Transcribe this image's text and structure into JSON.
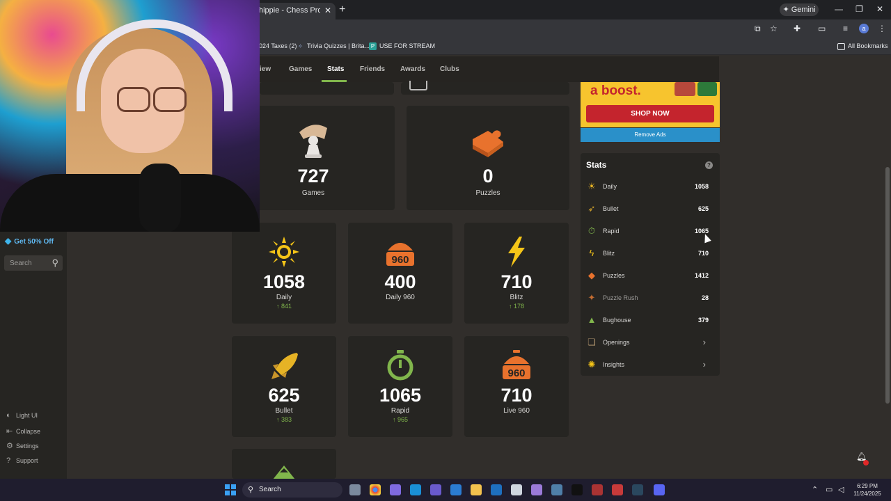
{
  "browser": {
    "tab_title": "hippie - Chess Profile - C",
    "tab_close": "✕",
    "new_tab": "+",
    "gemini_label": "Gemini",
    "bookmarks": [
      {
        "label": "024 Taxes (2)"
      },
      {
        "label": "Trivia Quizzes | Brita..."
      },
      {
        "label": "USE FOR STREAM"
      }
    ],
    "all_bookmarks": "All Bookmarks",
    "avatar_initial": "a"
  },
  "sidebar": {
    "promo": "Get 50% Off",
    "search_placeholder": "Search",
    "links": [
      {
        "label": "Light UI",
        "icon": "contrast-icon"
      },
      {
        "label": "Collapse",
        "icon": "collapse-icon"
      },
      {
        "label": "Settings",
        "icon": "gear-icon"
      },
      {
        "label": "Support",
        "icon": "help-icon"
      }
    ]
  },
  "nav": {
    "items": [
      {
        "label": "iew"
      },
      {
        "label": "Games"
      },
      {
        "label": "Stats"
      },
      {
        "label": "Friends"
      },
      {
        "label": "Awards"
      },
      {
        "label": "Clubs"
      }
    ],
    "active": "Stats"
  },
  "summary": [
    {
      "value": "727",
      "label": "Games",
      "icon": "pawn-hand-icon"
    },
    {
      "value": "0",
      "label": "Puzzles",
      "icon": "puzzle-icon"
    }
  ],
  "ratings": [
    {
      "value": "1058",
      "label": "Daily",
      "delta": "841",
      "icon": "sun-icon"
    },
    {
      "value": "400",
      "label": "Daily 960",
      "delta": "",
      "icon": "daily960-icon"
    },
    {
      "value": "710",
      "label": "Blitz",
      "delta": "178",
      "icon": "lightning-icon"
    },
    {
      "value": "625",
      "label": "Bullet",
      "delta": "383",
      "icon": "bullet-icon"
    },
    {
      "value": "1065",
      "label": "Rapid",
      "delta": "965",
      "icon": "stopwatch-icon"
    },
    {
      "value": "710",
      "label": "Live 960",
      "delta": "",
      "icon": "live960-icon"
    }
  ],
  "ad": {
    "headline": "a boost.",
    "button": "SHOP NOW",
    "remove": "Remove Ads"
  },
  "stats_panel": {
    "title": "Stats",
    "help": "?",
    "rows": [
      {
        "name": "Daily",
        "value": "1058",
        "icon": "sun-icon",
        "color": "#e6b325"
      },
      {
        "name": "Bullet",
        "value": "625",
        "icon": "bullet-icon",
        "color": "#d9a82b"
      },
      {
        "name": "Rapid",
        "value": "1065",
        "icon": "stopwatch-icon",
        "color": "#81b64c"
      },
      {
        "name": "Blitz",
        "value": "710",
        "icon": "lightning-icon",
        "color": "#f5c518"
      },
      {
        "name": "Puzzles",
        "value": "1412",
        "icon": "puzzle-icon",
        "color": "#e8722d"
      },
      {
        "name": "Puzzle Rush",
        "value": "28",
        "icon": "puzzle-rush-icon",
        "color": "#c56d31"
      },
      {
        "name": "Bughouse",
        "value": "379",
        "icon": "bughouse-icon",
        "color": "#81b64c"
      },
      {
        "name": "Openings",
        "value": "",
        "icon": "book-icon",
        "color": "#a88e6a"
      },
      {
        "name": "Insights",
        "value": "",
        "icon": "lightbulb-icon",
        "color": "#f5c518"
      }
    ]
  },
  "taskbar": {
    "search": "Search",
    "time": "6:29 PM",
    "date": "11/24/2025"
  },
  "colors": {
    "accent_green": "#81b64c",
    "background": "#312e2b",
    "card": "#262522"
  }
}
